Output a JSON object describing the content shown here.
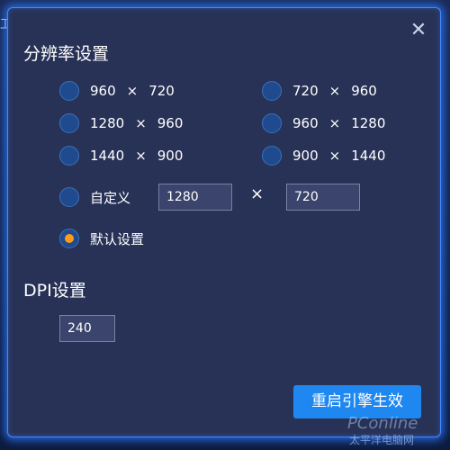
{
  "background": {
    "text": "卫心"
  },
  "dialog": {
    "close_glyph": "✕",
    "resolution": {
      "title": "分辨率设置",
      "options": [
        {
          "w": "960",
          "h": "720"
        },
        {
          "w": "720",
          "h": "960"
        },
        {
          "w": "1280",
          "h": "960"
        },
        {
          "w": "960",
          "h": "1280"
        },
        {
          "w": "1440",
          "h": "900"
        },
        {
          "w": "900",
          "h": "1440"
        }
      ],
      "times_glyph": "×",
      "custom_label": "自定义",
      "custom_width": "1280",
      "custom_height": "720",
      "default_label": "默认设置",
      "selected": "默认设置"
    },
    "dpi": {
      "title": "DPI设置",
      "value": "240"
    },
    "apply_label": "重启引擎生效"
  },
  "watermark": {
    "text_en": "PConline",
    "text_cn": "太平洋电脑网"
  },
  "colors": {
    "accent": "#1f88f0",
    "radio_selected": "#ff9a1a",
    "dialog_bg": "#283257",
    "glow": "#4a86ff"
  }
}
